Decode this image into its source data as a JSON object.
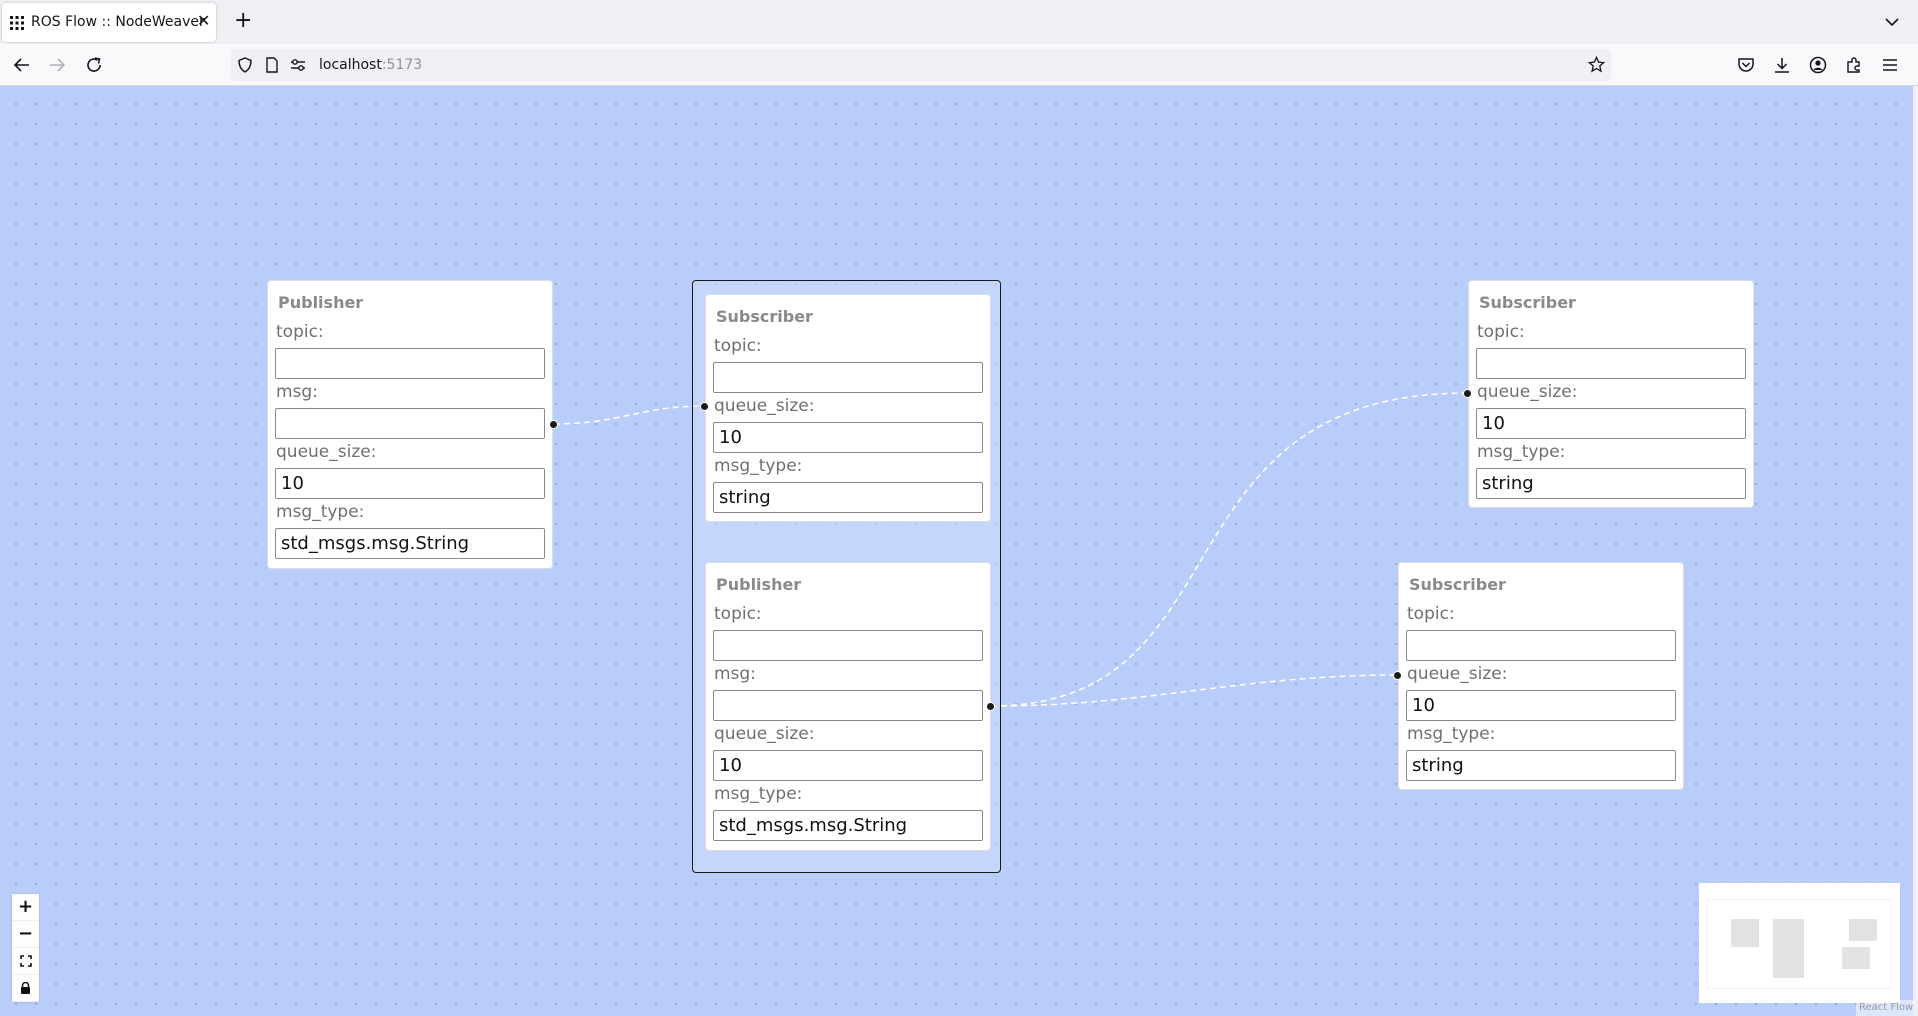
{
  "browser": {
    "tab_title": "ROS Flow :: NodeWeaver",
    "close_glyph": "✕",
    "new_tab_glyph": "+",
    "url_host": "localhost",
    "url_port": ":5173"
  },
  "nodes": {
    "publisher_1": {
      "title": "Publisher",
      "topic_label": "topic:",
      "topic_value": "",
      "msg_label": "msg:",
      "msg_value": "",
      "queue_size_label": "queue_size:",
      "queue_size_value": "10",
      "msg_type_label": "msg_type:",
      "msg_type_value": "std_msgs.msg.String"
    },
    "subscriber_1": {
      "title": "Subscriber",
      "topic_label": "topic:",
      "topic_value": "",
      "queue_size_label": "queue_size:",
      "queue_size_value": "10",
      "msg_type_label": "msg_type:",
      "msg_type_value": "string"
    },
    "publisher_2": {
      "title": "Publisher",
      "topic_label": "topic:",
      "topic_value": "",
      "msg_label": "msg:",
      "msg_value": "",
      "queue_size_label": "queue_size:",
      "queue_size_value": "10",
      "msg_type_label": "msg_type:",
      "msg_type_value": "std_msgs.msg.String"
    },
    "subscriber_2": {
      "title": "Subscriber",
      "topic_label": "topic:",
      "topic_value": "",
      "queue_size_label": "queue_size:",
      "queue_size_value": "10",
      "msg_type_label": "msg_type:",
      "msg_type_value": "string"
    },
    "subscriber_3": {
      "title": "Subscriber",
      "topic_label": "topic:",
      "topic_value": "",
      "queue_size_label": "queue_size:",
      "queue_size_value": "10",
      "msg_type_label": "msg_type:",
      "msg_type_value": "string"
    }
  },
  "controls": {
    "zoom_in": "+",
    "zoom_out": "−"
  },
  "attribution": "React Flow",
  "colors": {
    "canvas_background": "#b9cdfb",
    "edge": "#ffffff",
    "handle": "#1a1a1a"
  },
  "icons": [
    "grid-icon",
    "close-icon",
    "new-tab-icon",
    "tab-list-icon",
    "back-icon",
    "forward-icon",
    "reload-icon",
    "shield-icon",
    "page-icon",
    "permissions-icon",
    "bookmark-star-icon",
    "pocket-icon",
    "download-icon",
    "account-icon",
    "extensions-icon",
    "menu-icon",
    "fit-view-icon",
    "lock-icon"
  ]
}
